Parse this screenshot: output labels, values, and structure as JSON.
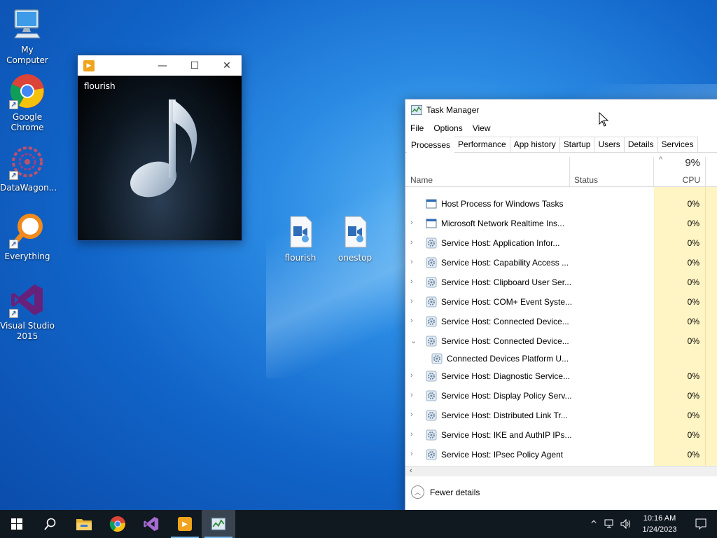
{
  "desktop": {
    "icons": [
      {
        "label": "My Computer",
        "icon": "monitor-icon"
      },
      {
        "label": "Google Chrome",
        "icon": "chrome-icon"
      },
      {
        "label": "DataWagon...",
        "icon": "datawagon-icon"
      },
      {
        "label": "Everything",
        "icon": "everything-search-icon"
      },
      {
        "label": "Visual Studio 2015",
        "icon": "visual-studio-icon"
      },
      {
        "label": "flourish",
        "icon": "video-file-icon"
      },
      {
        "label": "onestop",
        "icon": "video-file-icon"
      }
    ]
  },
  "media_window": {
    "title": "flourish",
    "controls": {
      "minimize": "—",
      "maximize": "☐",
      "close": "✕"
    }
  },
  "task_manager": {
    "title": "Task Manager",
    "menu": [
      "File",
      "Options",
      "View"
    ],
    "tabs": [
      "Processes",
      "Performance",
      "App history",
      "Startup",
      "Users",
      "Details",
      "Services"
    ],
    "active_tab": "Processes",
    "columns": {
      "name": "Name",
      "status": "Status",
      "cpu_percent": "9%",
      "cpu": "CPU"
    },
    "rows": [
      {
        "name": "Host Process for Windows Tasks",
        "cpu": "0%",
        "expander": "",
        "child": false
      },
      {
        "name": "Microsoft Network Realtime Ins...",
        "cpu": "0%",
        "expander": "›",
        "child": false
      },
      {
        "name": "Service Host: Application Infor...",
        "cpu": "0%",
        "expander": "›",
        "child": false
      },
      {
        "name": "Service Host: Capability Access ...",
        "cpu": "0%",
        "expander": "›",
        "child": false
      },
      {
        "name": "Service Host: Clipboard User Ser...",
        "cpu": "0%",
        "expander": "›",
        "child": false
      },
      {
        "name": "Service Host: COM+ Event Syste...",
        "cpu": "0%",
        "expander": "›",
        "child": false
      },
      {
        "name": "Service Host: Connected Device...",
        "cpu": "0%",
        "expander": "›",
        "child": false
      },
      {
        "name": "Service Host: Connected Device...",
        "cpu": "0%",
        "expander": "⌄",
        "child": false
      },
      {
        "name": "Connected Devices Platform U...",
        "cpu": "",
        "expander": "",
        "child": true
      },
      {
        "name": "Service Host: Diagnostic Service...",
        "cpu": "0%",
        "expander": "›",
        "child": false
      },
      {
        "name": "Service Host: Display Policy Serv...",
        "cpu": "0%",
        "expander": "›",
        "child": false
      },
      {
        "name": "Service Host: Distributed Link Tr...",
        "cpu": "0%",
        "expander": "›",
        "child": false
      },
      {
        "name": "Service Host: IKE and AuthIP IPs...",
        "cpu": "0%",
        "expander": "›",
        "child": false
      },
      {
        "name": "Service Host: IPsec Policy Agent",
        "cpu": "0%",
        "expander": "›",
        "child": false
      }
    ],
    "footer": "Fewer details"
  },
  "taskbar": {
    "apps": [
      "start-icon",
      "search-icon",
      "file-explorer-icon",
      "chrome-icon",
      "visual-studio-icon",
      "media-player-icon",
      "task-manager-icon"
    ],
    "clock_time": "10:16 AM",
    "clock_date": "1/24/2023",
    "tray_chevron": "^"
  },
  "colors": {
    "desktop_blue": "#1164c8",
    "taskbar": "#101820",
    "cpu_highlight": "#fff4c4",
    "running_indicator": "#76b9ed"
  }
}
